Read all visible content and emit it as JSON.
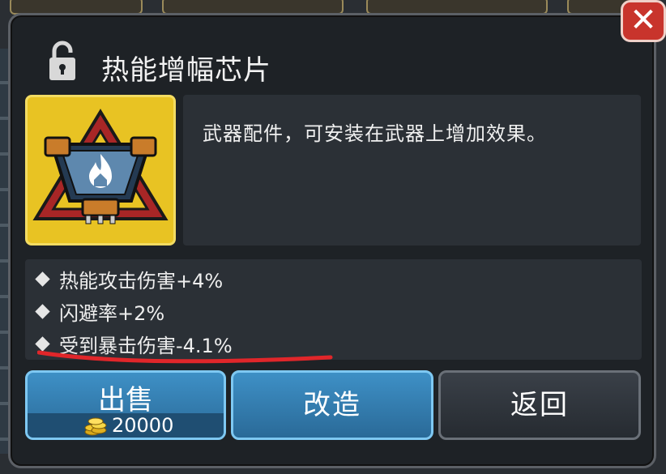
{
  "dialog": {
    "title": "热能增幅芯片",
    "description": "武器配件，可安装在武器上增加效果。",
    "stats": [
      "热能攻击伤害+4%",
      "闪避率+2%",
      "受到暴击伤害-4.1%"
    ],
    "buttons": {
      "sell_label": "出售",
      "sell_price": "20000",
      "modify_label": "改造",
      "back_label": "返回"
    },
    "close_label": "✕"
  },
  "icons": {
    "lock": "unlock-icon",
    "item": "thermal-chip-icon",
    "coin": "coin-stack-icon"
  },
  "colors": {
    "item_rarity": "#e8c323",
    "button_blue": "#3e90c6",
    "close_red": "#c8342c",
    "underline_red": "#e0262a"
  }
}
